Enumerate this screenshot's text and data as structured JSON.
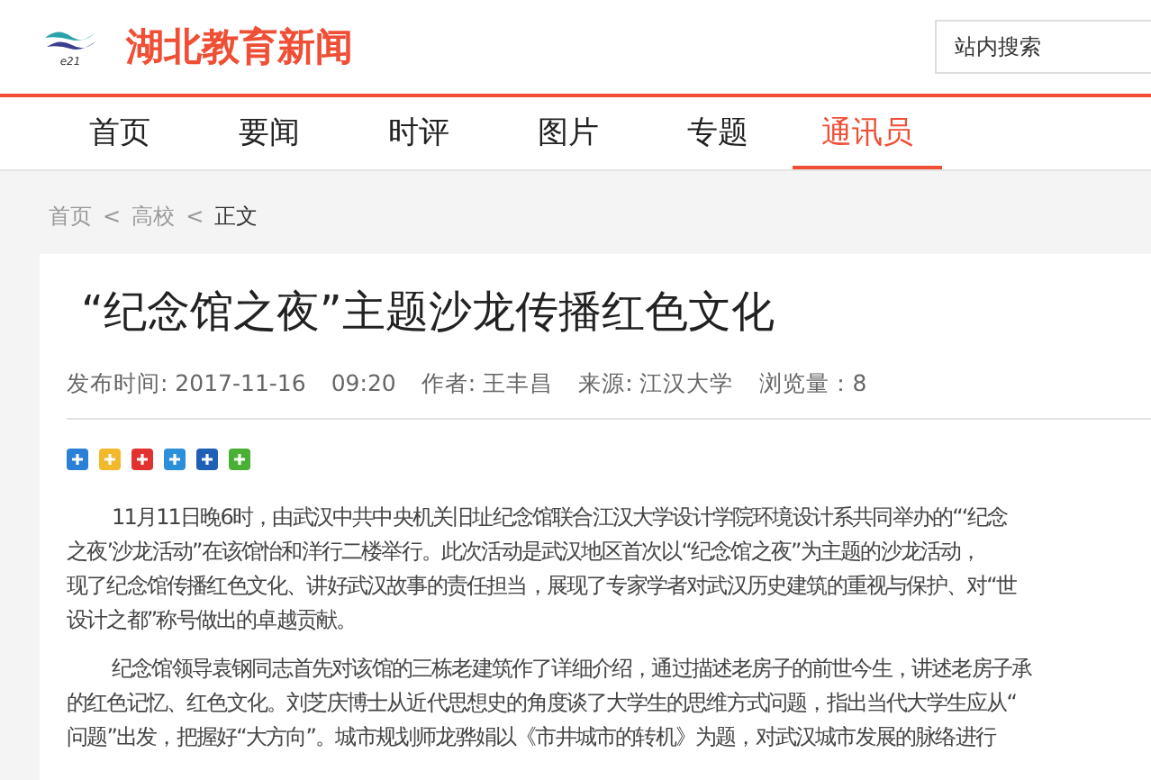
{
  "header": {
    "logo_mark": "e21",
    "site_name": "湖北教育新闻",
    "search": {
      "placeholder": "站内搜索"
    }
  },
  "nav": [
    {
      "label": "首页",
      "selected": false
    },
    {
      "label": "要闻",
      "selected": false
    },
    {
      "label": "时评",
      "selected": false
    },
    {
      "label": "图片",
      "selected": false
    },
    {
      "label": "专题",
      "selected": false
    },
    {
      "label": "通讯员",
      "selected": true
    }
  ],
  "breadcrumb": [
    {
      "label": "首页",
      "current": false
    },
    {
      "label": "高校",
      "current": false
    },
    {
      "label": "正文",
      "current": true
    }
  ],
  "breadcrumb_separator": "<",
  "article": {
    "title": "“纪念馆之夜”主题沙龙传播红色文化",
    "meta": [
      "发布时间: 2017-11-16",
      "09:20",
      "作者: 王丰昌",
      "来源: 江汉大学",
      "浏览量：8"
    ],
    "paragraphs": [
      [
        "11月11日晚6时，由武汉中共中央机关旧址纪念馆联合江汉大学设计学院环境设计系共同举办的“‘纪念",
        "之夜’沙龙活动”在该馆怡和洋行二楼举行。此次活动是武汉地区首次以“纪念馆之夜”为主题的沙龙活动，",
        "现了纪念馆传播红色文化、讲好武汉故事的责任担当，展现了专家学者对武汉历史建筑的重视与保护、对“世",
        "设计之都”称号做出的卓越贡献。"
      ],
      [
        "纪念馆领导袁钢同志首先对该馆的三栋老建筑作了详细介绍，通过描述老房子的前世今生，讲述老房子承",
        "的红色记忆、红色文化。刘芝庆博士从近代思想史的角度谈了大学生的思维方式问题，指出当代大学生应从“",
        "问题”出发，把握好“大方向”。城市规划师龙骅娟以《市井城市的转机》为题，对武汉城市发展的脉络进行"
      ]
    ]
  }
}
